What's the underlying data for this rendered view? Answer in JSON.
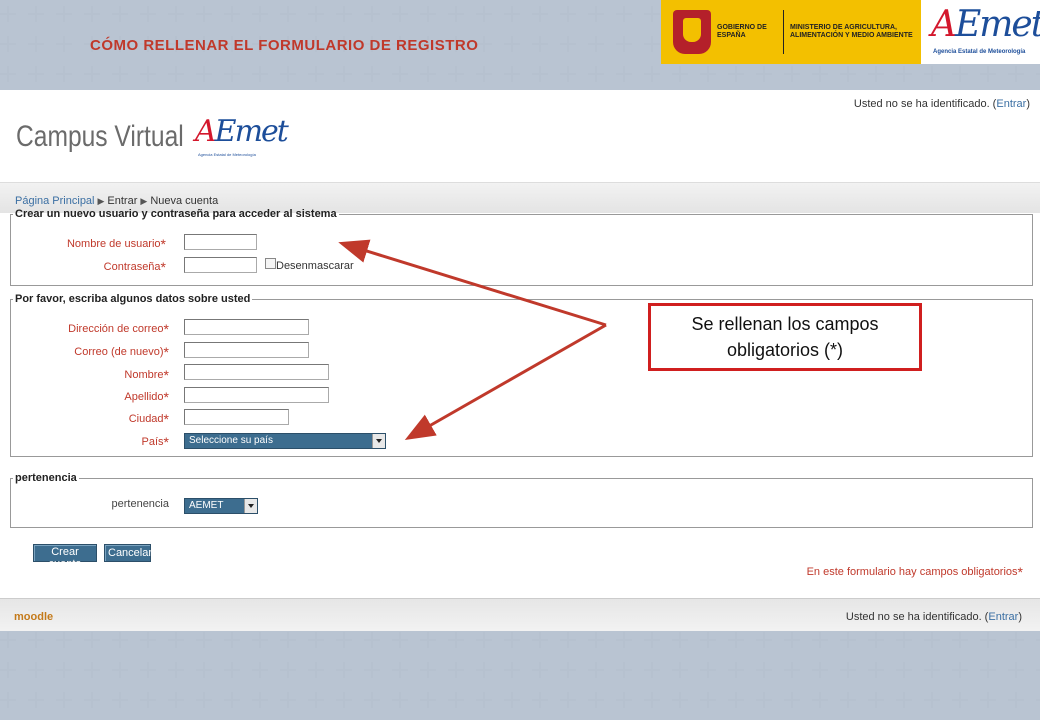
{
  "slide": {
    "title": "CÓMO RELLENAR EL FORMULARIO DE REGISTRO",
    "gov_text": "GOBIERNO DE ESPAÑA",
    "ministry_text": "MINISTERIO DE AGRICULTURA, ALIMENTACIÓN Y MEDIO AMBIENTE",
    "aemet_subtitle": "Agencia Estatal de Meteorología"
  },
  "header": {
    "login_status": "Usted no se ha identificado. (",
    "login_link": "Entrar",
    "login_close": ")",
    "campus_title": "Campus Virtual",
    "campus_logo_sub": "Agencia Estatal de Meteorología"
  },
  "breadcrumb": {
    "home": "Página Principal",
    "login": "Entrar",
    "current": "Nueva cuenta"
  },
  "section_account": {
    "legend": "Crear un nuevo usuario y contraseña para acceder al sistema",
    "username_label": "Nombre de usuario",
    "password_label": "Contraseña",
    "unmask_label": "Desenmascarar"
  },
  "section_details": {
    "legend": "Por favor, escriba algunos datos sobre usted",
    "email_label": "Dirección de correo",
    "email2_label": "Correo (de nuevo)",
    "firstname_label": "Nombre",
    "lastname_label": "Apellido",
    "city_label": "Ciudad",
    "country_label": "País",
    "country_value": "Seleccione su país"
  },
  "section_membership": {
    "legend": "pertenencia",
    "label": "pertenencia",
    "value": "AEMET"
  },
  "buttons": {
    "create": "Crear cuenta",
    "cancel": "Cancelar"
  },
  "required_note": "En este formulario hay campos obligatorios",
  "required_mark": "*",
  "footer": {
    "moodle": "moodle",
    "login_status": "Usted no se ha identificado. (",
    "login_link": "Entrar",
    "login_close": ")"
  },
  "annotation": {
    "text": "Se rellenan los campos obligatorios (*)",
    "color": "#d01f1f"
  },
  "colors": {
    "accent_red": "#c0392b",
    "select_blue": "#3d6d8f",
    "link_blue": "#3b6fa3",
    "gov_yellow": "#f3c000"
  }
}
